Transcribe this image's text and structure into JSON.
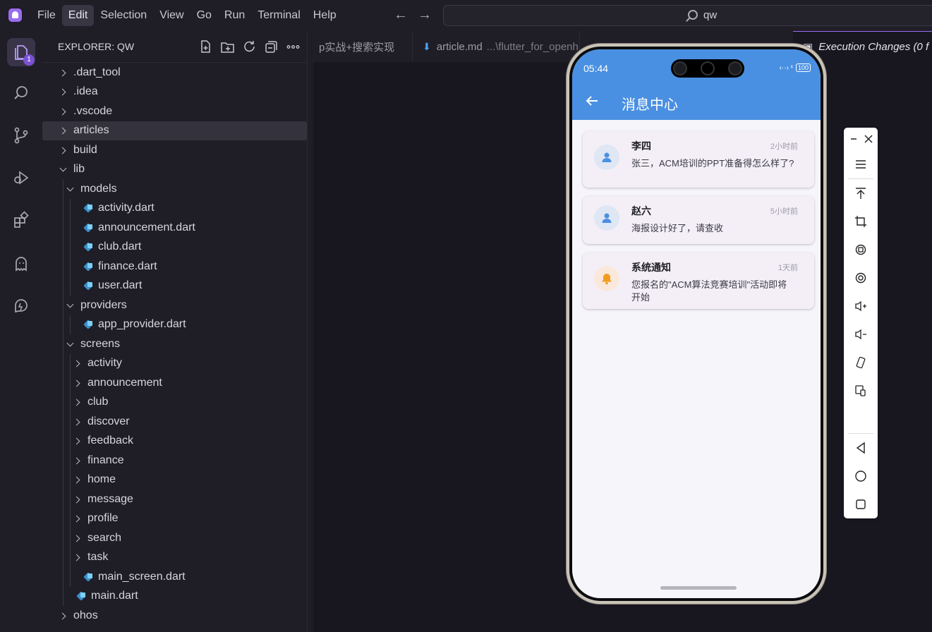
{
  "menubar": {
    "items": [
      "File",
      "Edit",
      "Selection",
      "View",
      "Go",
      "Run",
      "Terminal",
      "Help"
    ],
    "active": "Edit"
  },
  "search": {
    "value": "qw"
  },
  "activity": {
    "badge": "1"
  },
  "sidebar": {
    "title": "EXPLORER: QW",
    "tree": [
      {
        "label": ".dart_tool",
        "type": "folder",
        "open": false,
        "level": 0
      },
      {
        "label": ".idea",
        "type": "folder",
        "open": false,
        "level": 0
      },
      {
        "label": ".vscode",
        "type": "folder",
        "open": false,
        "level": 0
      },
      {
        "label": "articles",
        "type": "folder",
        "open": false,
        "level": 0,
        "selected": true
      },
      {
        "label": "build",
        "type": "folder",
        "open": false,
        "level": 0
      },
      {
        "label": "lib",
        "type": "folder",
        "open": true,
        "level": 0
      },
      {
        "label": "models",
        "type": "folder",
        "open": true,
        "level": 1
      },
      {
        "label": "activity.dart",
        "type": "dart",
        "level": 2
      },
      {
        "label": "announcement.dart",
        "type": "dart",
        "level": 2
      },
      {
        "label": "club.dart",
        "type": "dart",
        "level": 2
      },
      {
        "label": "finance.dart",
        "type": "dart",
        "level": 2
      },
      {
        "label": "user.dart",
        "type": "dart",
        "level": 2
      },
      {
        "label": "providers",
        "type": "folder",
        "open": true,
        "level": 1
      },
      {
        "label": "app_provider.dart",
        "type": "dart",
        "level": 2
      },
      {
        "label": "screens",
        "type": "folder",
        "open": true,
        "level": 1
      },
      {
        "label": "activity",
        "type": "folder",
        "open": false,
        "level": 2
      },
      {
        "label": "announcement",
        "type": "folder",
        "open": false,
        "level": 2
      },
      {
        "label": "club",
        "type": "folder",
        "open": false,
        "level": 2
      },
      {
        "label": "discover",
        "type": "folder",
        "open": false,
        "level": 2
      },
      {
        "label": "feedback",
        "type": "folder",
        "open": false,
        "level": 2
      },
      {
        "label": "finance",
        "type": "folder",
        "open": false,
        "level": 2
      },
      {
        "label": "home",
        "type": "folder",
        "open": false,
        "level": 2
      },
      {
        "label": "message",
        "type": "folder",
        "open": false,
        "level": 2
      },
      {
        "label": "profile",
        "type": "folder",
        "open": false,
        "level": 2
      },
      {
        "label": "search",
        "type": "folder",
        "open": false,
        "level": 2
      },
      {
        "label": "task",
        "type": "folder",
        "open": false,
        "level": 2
      },
      {
        "label": "main_screen.dart",
        "type": "dart",
        "level": 2
      },
      {
        "label": "main.dart",
        "type": "dart",
        "level": 1
      },
      {
        "label": "ohos",
        "type": "folder",
        "open": false,
        "level": 0
      }
    ]
  },
  "tabs": [
    {
      "label": "p实战+搜索实现"
    },
    {
      "label": "article.md",
      "sub": "...\\flutter_for_openh"
    },
    {
      "label": "Execution Changes (0 f",
      "active": true
    }
  ],
  "phone": {
    "time": "05:44",
    "sys": "‹··› ˣ",
    "battery": "100",
    "title": "消息中心",
    "messages": [
      {
        "name": "李四",
        "time": "2小时前",
        "text": "张三，ACM培训的PPT准备得怎么样了?",
        "icon": "person-icon"
      },
      {
        "name": "赵六",
        "time": "5小时前",
        "text": "海报设计好了，请查收",
        "icon": "person-icon"
      },
      {
        "name": "系统通知",
        "time": "1天前",
        "text": "您报名的\"ACM算法竞赛培训\"活动即将开始",
        "icon": "bell-icon"
      }
    ]
  },
  "colors": {
    "accent": "#9a6cf0",
    "appbar": "#4a90e2",
    "bell": "#f29c1f"
  }
}
